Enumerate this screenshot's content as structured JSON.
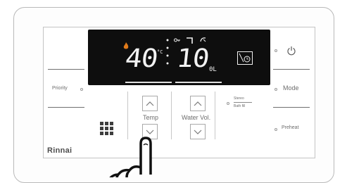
{
  "display": {
    "temp_value": "40",
    "temp_unit": "°C",
    "volume_value": "10",
    "volume_unit": "0L"
  },
  "buttons": {
    "priority_label": "Priority",
    "mode_label": "Mode",
    "preheat_label": "Preheat",
    "temp_label": "Temp",
    "water_vol_label": "Water Vol.",
    "bath_fill_top": "Stereo",
    "bath_fill_label": "Bath fill"
  },
  "brand": {
    "name": "Rinnai"
  },
  "colors": {
    "display_bg": "#0e0e0e",
    "flame": "#e07a1a",
    "segment": "#f2f2f2"
  }
}
